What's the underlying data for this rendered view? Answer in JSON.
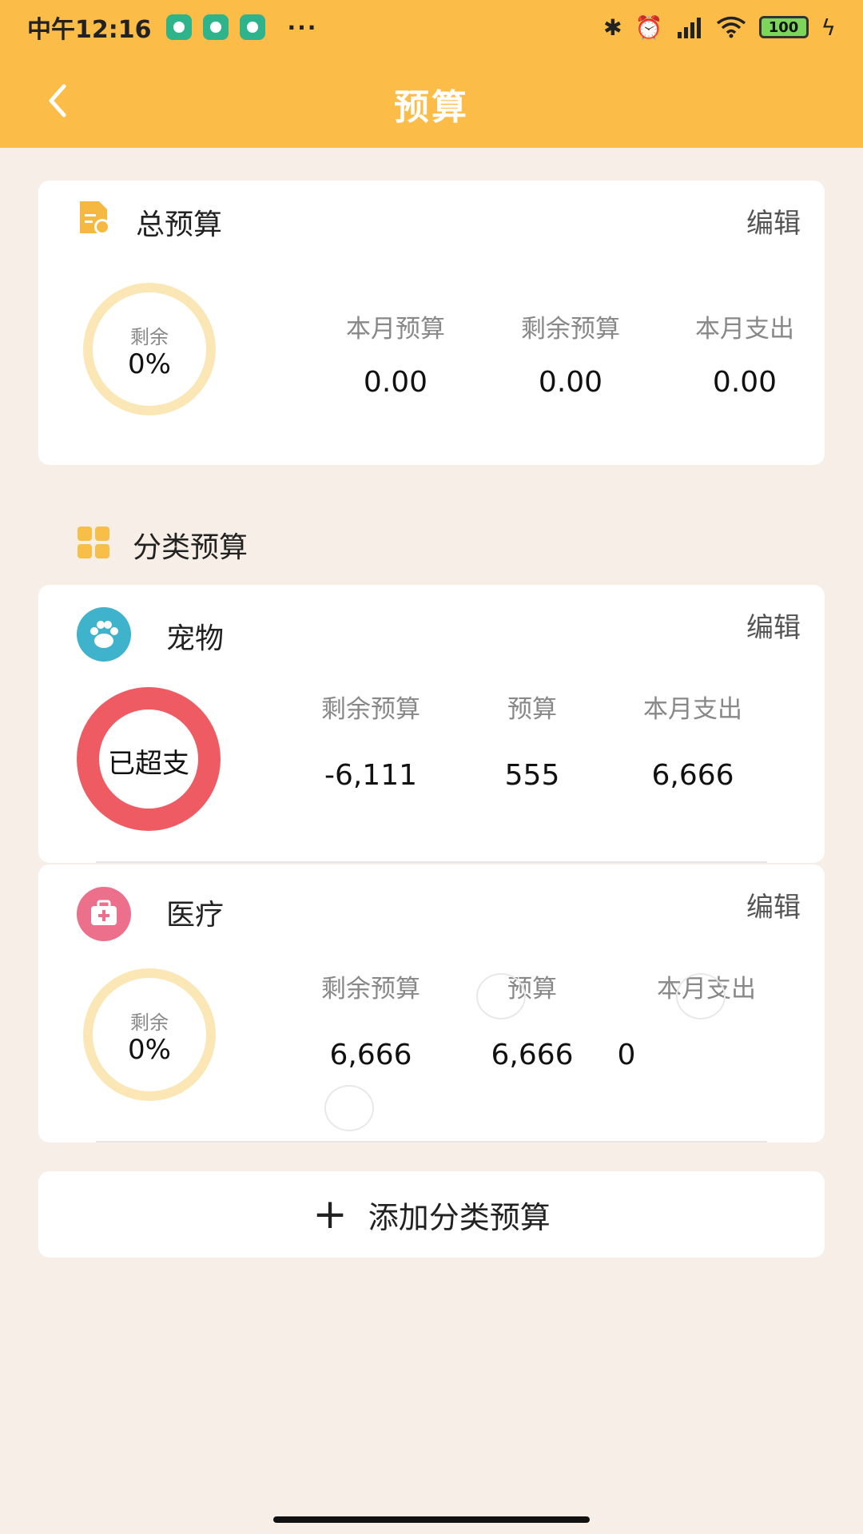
{
  "status_bar": {
    "time": "中午12:16",
    "more": "···",
    "battery": "100",
    "icons": [
      "app-badge-icon",
      "bluetooth-icon",
      "alarm-icon",
      "signal-icon",
      "wifi-icon",
      "battery-icon",
      "charging-icon"
    ]
  },
  "appbar": {
    "title": "预算",
    "back_icon": "chevron-left-icon"
  },
  "total_budget": {
    "title": "总预算",
    "edit": "编辑",
    "ring_label": "剩余",
    "ring_value": "0%",
    "stats": [
      {
        "label": "本月预算",
        "value": "0.00"
      },
      {
        "label": "剩余预算",
        "value": "0.00"
      },
      {
        "label": "本月支出",
        "value": "0.00"
      }
    ]
  },
  "category_section": {
    "title": "分类预算"
  },
  "categories": [
    {
      "name": "宠物",
      "icon": "paw-icon",
      "edit": "编辑",
      "ring_text": "已超支",
      "stats": [
        {
          "label": "剩余预算",
          "value": "-6,111"
        },
        {
          "label": "预算",
          "value": "555"
        },
        {
          "label": "本月支出",
          "value": "6,666"
        }
      ]
    },
    {
      "name": "医疗",
      "icon": "medical-kit-icon",
      "edit": "编辑",
      "ring_label": "剩余",
      "ring_value": "0%",
      "stats": [
        {
          "label": "剩余预算",
          "value": "6,666"
        },
        {
          "label": "预算",
          "value": "6,666"
        },
        {
          "label": "本月支出",
          "value": "0"
        }
      ]
    }
  ],
  "add_button": {
    "label": "添加分类预算"
  },
  "colors": {
    "brand": "#fbbd48",
    "over_budget": "#ee5b63",
    "ring_normal": "#fbe7b5",
    "pet_icon_bg": "#3fb2cc",
    "medical_icon_bg": "#ec6f8b"
  }
}
